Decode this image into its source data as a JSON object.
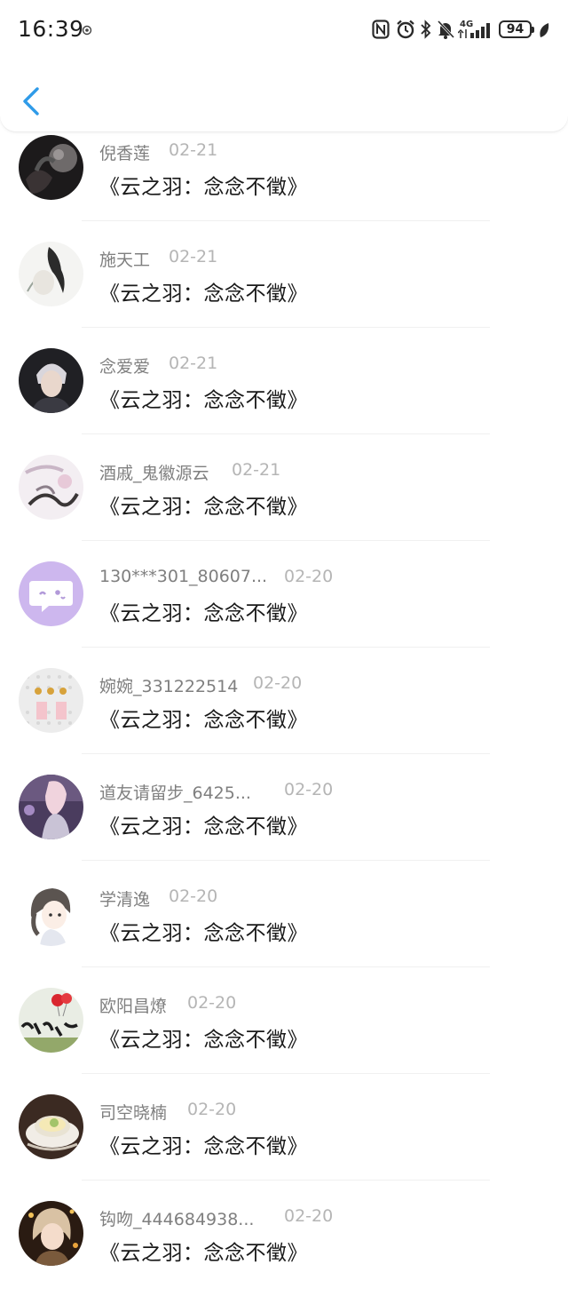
{
  "status_bar": {
    "time": "16:39",
    "network": "4G",
    "battery": "94",
    "icons": [
      "nfc-icon",
      "alarm-icon",
      "bluetooth-icon",
      "mute-icon",
      "signal-icon"
    ]
  },
  "nav": {
    "back_icon": "chevron-left-icon",
    "accent": "#2f9be8"
  },
  "comments": [
    {
      "name": "倪香莲",
      "date": "02-21",
      "title": "《云之羽：念念不徵》",
      "avatar": "photo-dark-cat"
    },
    {
      "name": "施天工",
      "date": "02-21",
      "title": "《云之羽：念念不徵》",
      "avatar": "ink-sketch"
    },
    {
      "name": "念爱爱",
      "date": "02-21",
      "title": "《云之羽：念念不徵》",
      "avatar": "photo-person"
    },
    {
      "name": "酒戚_鬼徽源云",
      "date": "02-21",
      "title": "《云之羽：念念不徵》",
      "avatar": "ink-painting"
    },
    {
      "name": "130***301_80607...",
      "date": "02-20",
      "title": "《云之羽：念念不徵》",
      "avatar": "chat-bubble-default"
    },
    {
      "name": "婉婉_331222514",
      "date": "02-20",
      "title": "《云之羽：念念不徵》",
      "avatar": "dotted-pattern"
    },
    {
      "name": "道友请留步_6425...",
      "date": "02-20",
      "title": "《云之羽：念念不徵》",
      "avatar": "photo-stage"
    },
    {
      "name": "学清逸",
      "date": "02-20",
      "title": "《云之羽：念念不徵》",
      "avatar": "anime-girl"
    },
    {
      "name": "欧阳昌燎",
      "date": "02-20",
      "title": "《云之羽：念念不徵》",
      "avatar": "calligraphy-balloons"
    },
    {
      "name": "司空晓楠",
      "date": "02-20",
      "title": "《云之羽：念念不徵》",
      "avatar": "teacup"
    },
    {
      "name": "钩吻_444684938...",
      "date": "02-20",
      "title": "《云之羽：念念不徵》",
      "avatar": "anime-portrait"
    }
  ]
}
